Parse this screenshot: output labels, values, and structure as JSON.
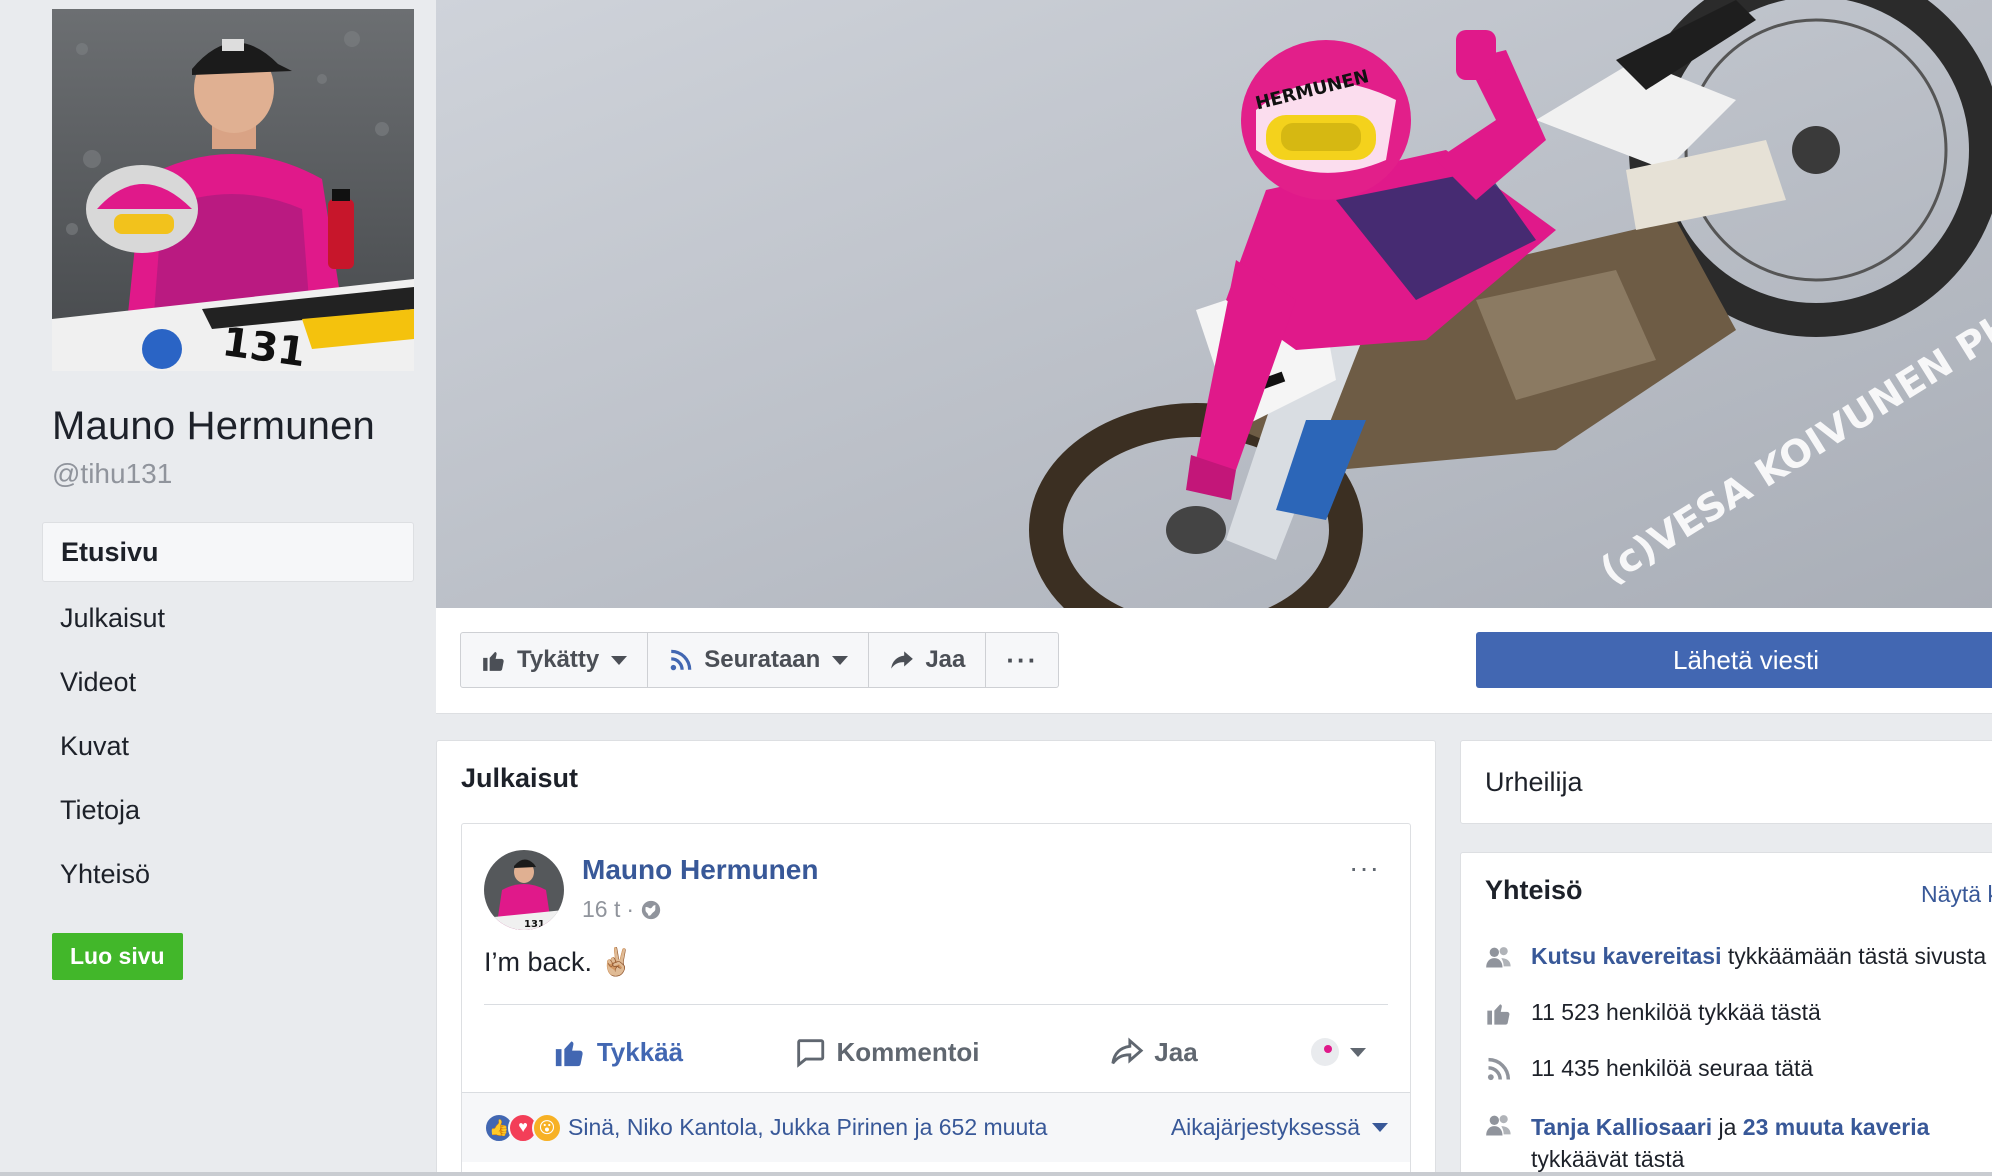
{
  "page": {
    "name": "Mauno Hermunen",
    "handle": "@tihu131"
  },
  "left_nav": {
    "items": [
      {
        "label": "Etusivu",
        "active": true
      },
      {
        "label": "Julkaisut"
      },
      {
        "label": "Videot"
      },
      {
        "label": "Kuvat"
      },
      {
        "label": "Tietoja"
      },
      {
        "label": "Yhteisö"
      }
    ],
    "create_page": "Luo sivu"
  },
  "cover": {
    "watermark": "(c)VESA KOIVUNEN PHOTOGRAPHY"
  },
  "actions": {
    "liked": "Tykätty",
    "following": "Seurataan",
    "share": "Jaa",
    "more": "···",
    "send_message": "Lähetä viesti"
  },
  "posts": {
    "heading": "Julkaisut",
    "post": {
      "author": "Mauno Hermunen",
      "time": "16 t",
      "text": "I’m back. ✌🏼",
      "more": "···",
      "like": "Tykkää",
      "comment": "Kommentoi",
      "share": "Jaa",
      "reactions": "Sinä, Niko Kantola, Jukka Pirinen ja 652 muuta",
      "sort": "Aikajärjestyksessä"
    }
  },
  "sidebar": {
    "category": "Urheilija",
    "community": {
      "title": "Yhteisö",
      "see_all": "Näytä kaikki",
      "invite_link": "Kutsu kavereitasi",
      "invite_rest": "tykkäämään tästä sivusta",
      "likes": "11 523 henkilöä tykkää tästä",
      "follows": "11 435 henkilöä seuraa tätä",
      "friend1": "Tanja Kalliosaari",
      "friends_join": "ja",
      "friends_more": "23 muuta kaveria",
      "friends_rest": "tykkäävät tästä"
    }
  },
  "colors": {
    "fb_blue": "#4267b2",
    "link": "#385898",
    "green": "#42b72a",
    "jersey_pink": "#e0198a"
  }
}
